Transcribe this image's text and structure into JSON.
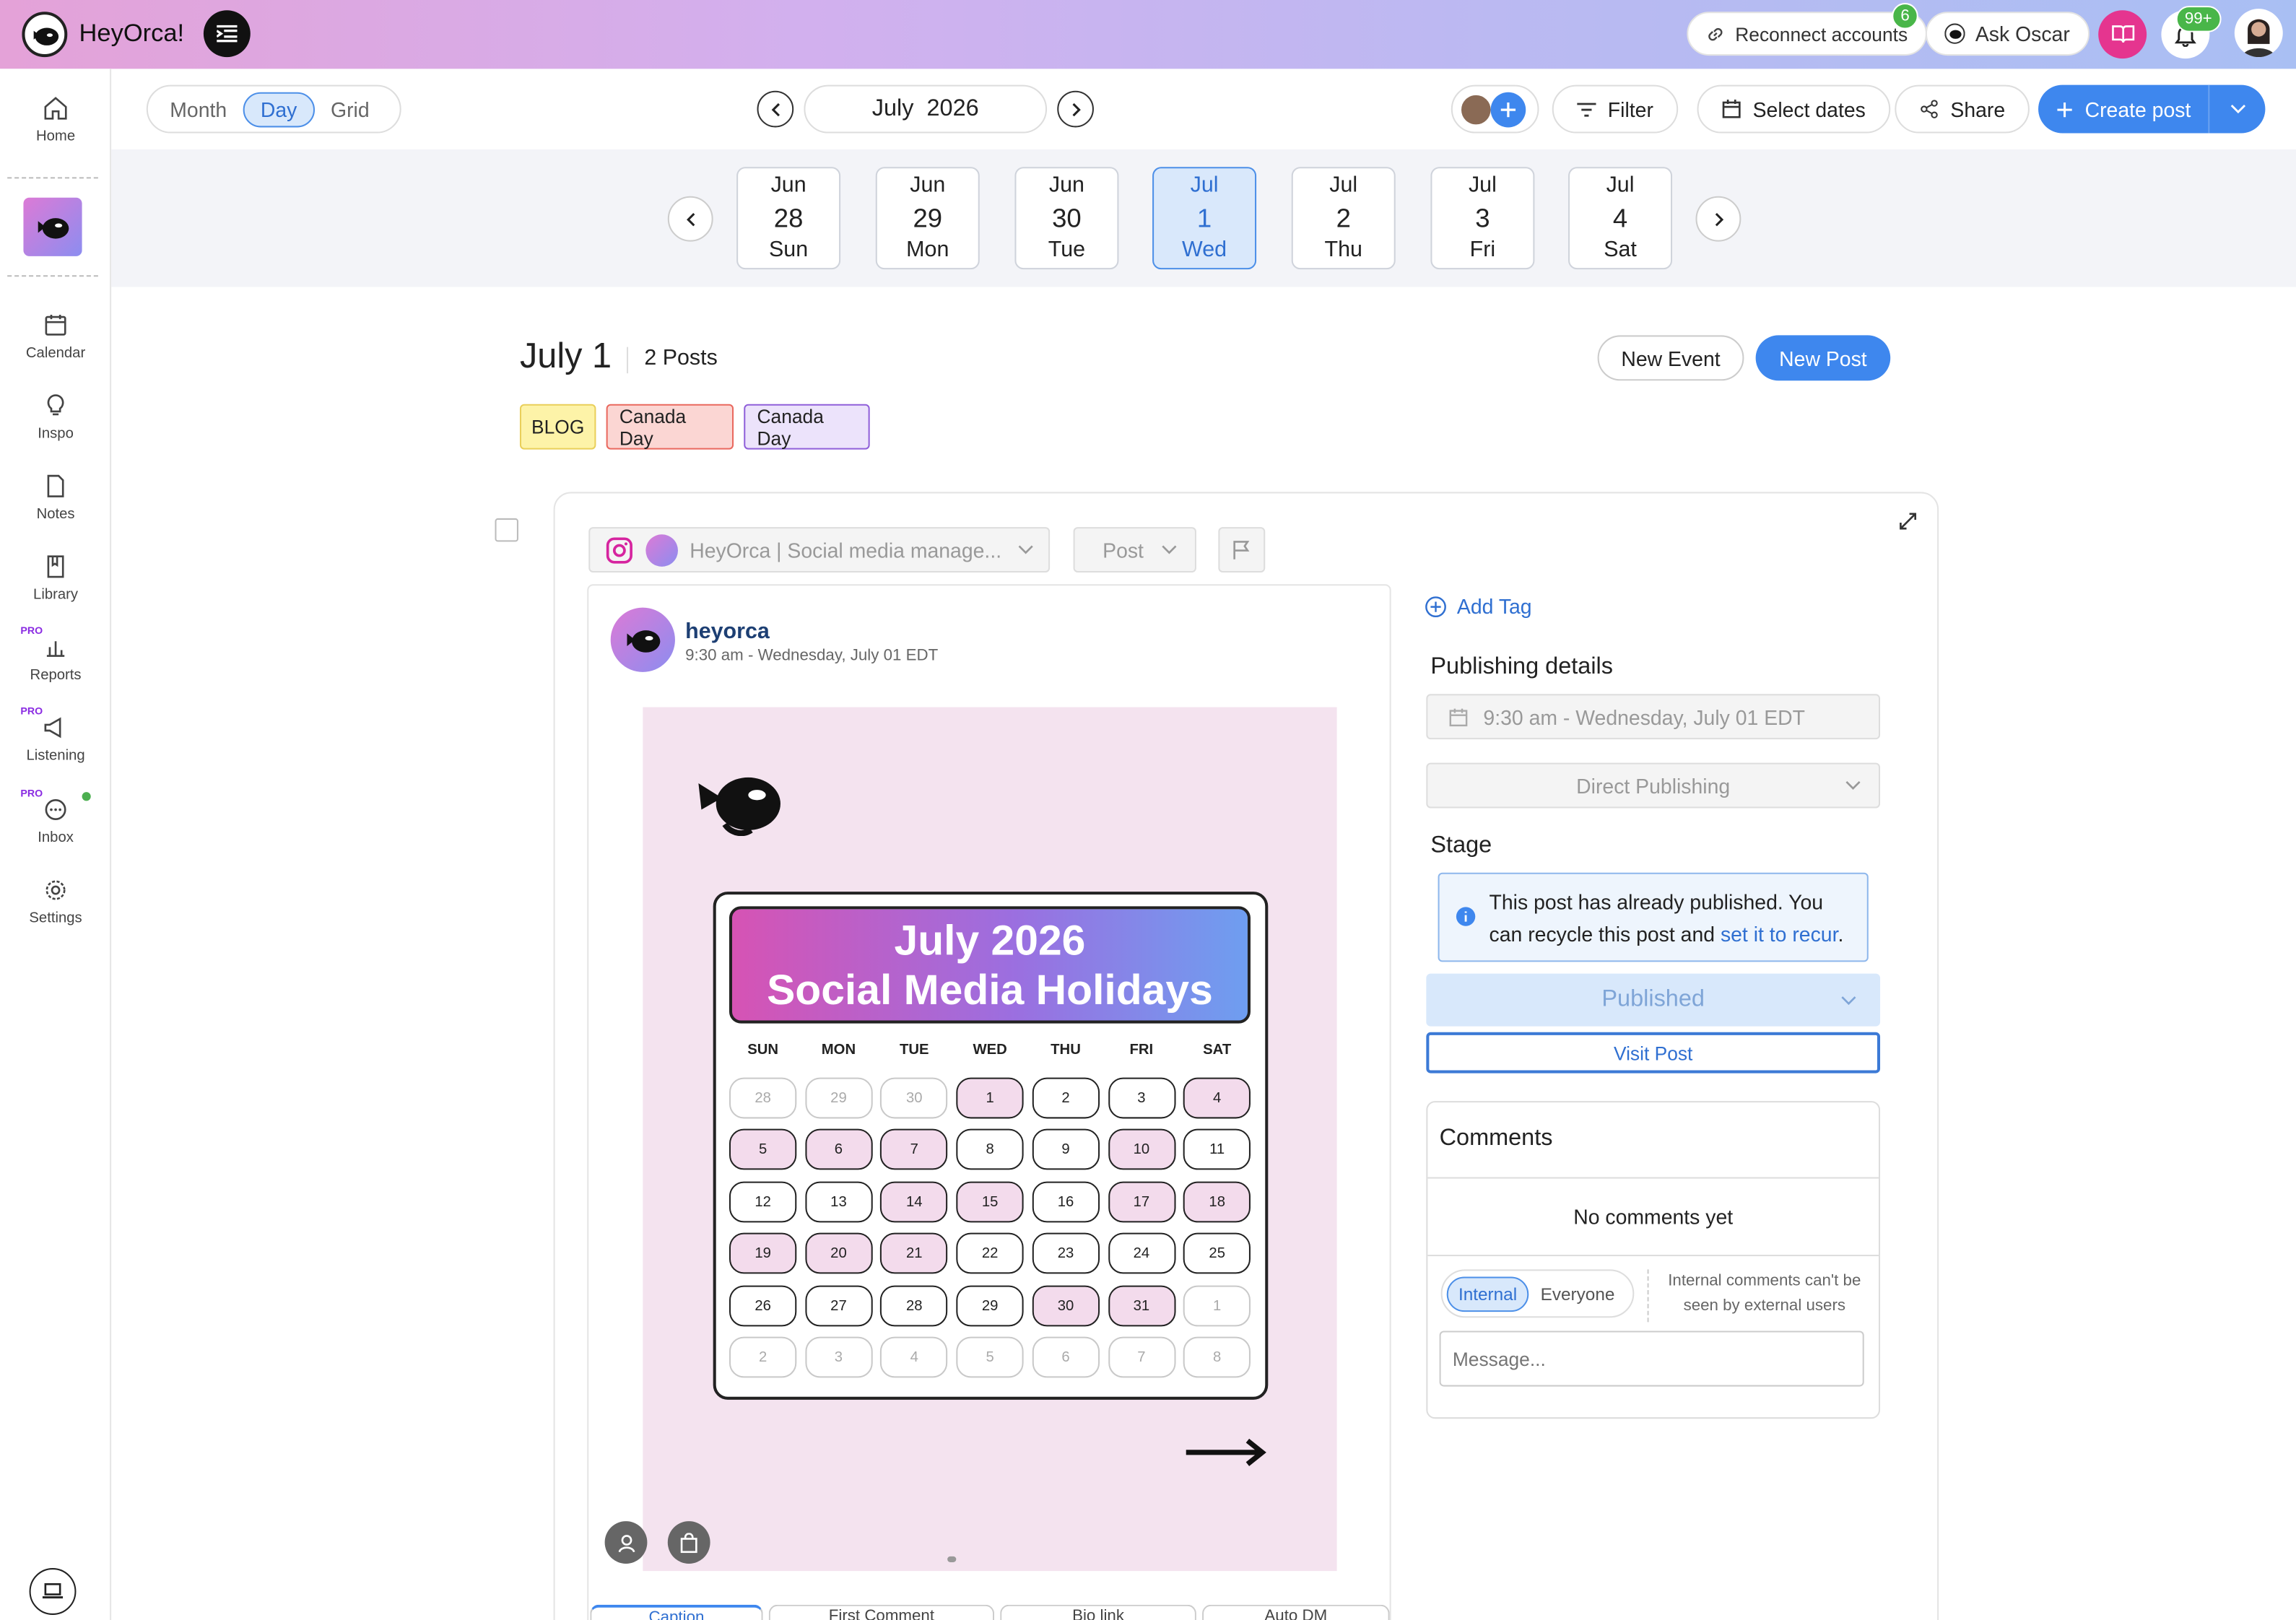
{
  "header": {
    "brand": "HeyOrca!",
    "reconnect_label": "Reconnect accounts",
    "reconnect_badge": "6",
    "ask_label": "Ask Oscar",
    "notif_badge": "99+",
    "colors": {
      "gradient_start": "#e4a2d8",
      "gradient_end": "#a9bff3",
      "accent": "#3e87ee"
    }
  },
  "sidebar": {
    "items": [
      {
        "label": "Home",
        "icon": "home-icon"
      },
      {
        "label": "Calendar",
        "icon": "calendar-icon"
      },
      {
        "label": "Inspo",
        "icon": "lightbulb-icon"
      },
      {
        "label": "Notes",
        "icon": "note-icon"
      },
      {
        "label": "Library",
        "icon": "library-icon"
      },
      {
        "label": "Reports",
        "icon": "chart-icon",
        "pro": "PRO"
      },
      {
        "label": "Listening",
        "icon": "megaphone-icon",
        "pro": "PRO"
      },
      {
        "label": "Inbox",
        "icon": "chat-icon",
        "pro": "PRO"
      },
      {
        "label": "Settings",
        "icon": "gear-icon"
      }
    ]
  },
  "toolbar": {
    "views": [
      "Month",
      "Day",
      "Grid"
    ],
    "active_view": "Day",
    "month": "July",
    "year": "2026",
    "filter_label": "Filter",
    "select_dates_label": "Select dates",
    "share_label": "Share",
    "create_label": "Create post"
  },
  "dates": [
    {
      "mon": "Jun",
      "day": "28",
      "dow": "Sun"
    },
    {
      "mon": "Jun",
      "day": "29",
      "dow": "Mon"
    },
    {
      "mon": "Jun",
      "day": "30",
      "dow": "Tue"
    },
    {
      "mon": "Jul",
      "day": "1",
      "dow": "Wed",
      "selected": true
    },
    {
      "mon": "Jul",
      "day": "2",
      "dow": "Thu"
    },
    {
      "mon": "Jul",
      "day": "3",
      "dow": "Fri"
    },
    {
      "mon": "Jul",
      "day": "4",
      "dow": "Sat"
    }
  ],
  "day": {
    "title": "July 1",
    "post_count": "2 Posts",
    "new_event": "New Event",
    "new_post": "New Post",
    "tags": [
      "BLOG",
      "Canada Day",
      "Canada Day"
    ]
  },
  "post": {
    "account": "HeyOrca | Social media manage...",
    "type": "Post",
    "username": "heyorca",
    "time": "9:30 am - Wednesday, July 01 EDT",
    "image": {
      "title_line1": "July 2026",
      "title_line2": "Social Media Holidays",
      "dow": [
        "SUN",
        "MON",
        "TUE",
        "WED",
        "THU",
        "FRI",
        "SAT"
      ],
      "weeks": [
        [
          "28",
          "29",
          "30",
          "1",
          "2",
          "3",
          "4"
        ],
        [
          "5",
          "6",
          "7",
          "8",
          "9",
          "10",
          "11"
        ],
        [
          "12",
          "13",
          "14",
          "15",
          "16",
          "17",
          "18"
        ],
        [
          "19",
          "20",
          "21",
          "22",
          "23",
          "24",
          "25"
        ],
        [
          "26",
          "27",
          "28",
          "29",
          "30",
          "31",
          "1"
        ],
        [
          "2",
          "3",
          "4",
          "5",
          "6",
          "7",
          "8"
        ]
      ]
    },
    "tabs": [
      "Caption",
      "First Comment",
      "Bio link",
      "Auto DM"
    ]
  },
  "details": {
    "add_tag": "Add Tag",
    "publishing_title": "Publishing details",
    "datetime": "9:30 am - Wednesday, July 01 EDT",
    "method": "Direct Publishing",
    "stage_title": "Stage",
    "info_text": "This post has already published. You can recycle this post and ",
    "info_link": "set it to recur",
    "info_end": ".",
    "stage_value": "Published",
    "visit_label": "Visit Post"
  },
  "comments": {
    "title": "Comments",
    "empty": "No comments yet",
    "tab_internal": "Internal",
    "tab_everyone": "Everyone",
    "note": "Internal comments can't be seen by external users",
    "placeholder": "Message..."
  }
}
